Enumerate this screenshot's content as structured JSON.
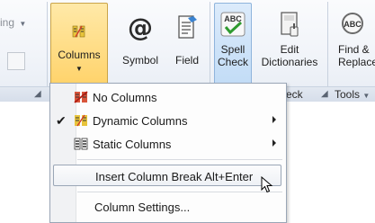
{
  "ribbon": {
    "stub_label": "ing",
    "buttons": [
      {
        "label": "Columns",
        "icon": "columns-icon"
      },
      {
        "label": "Symbol",
        "icon": "at-symbol-icon",
        "glyph": "@"
      },
      {
        "label": "Field",
        "icon": "field-icon"
      },
      {
        "label": "Spell Check",
        "line1": "Spell",
        "line2": "Check",
        "icon": "spell-check-icon"
      },
      {
        "label": "Edit Dictionaries",
        "line1": "Edit",
        "line2": "Dictionaries",
        "icon": "edit-dictionaries-icon"
      },
      {
        "label": "Find & Replace",
        "line1": "Find &",
        "line2": "Replace",
        "icon": "find-replace-icon"
      }
    ],
    "spell_check_icon_text": "ABC",
    "find_icon_text": "ABC",
    "groups": [
      {
        "label": "eck"
      },
      {
        "label": "Tools"
      }
    ]
  },
  "menu": {
    "items": [
      {
        "label": "No Columns",
        "icon": "no-columns-icon",
        "checked": false,
        "submenu": false
      },
      {
        "label": "Dynamic Columns",
        "icon": "dynamic-columns-icon",
        "checked": true,
        "submenu": true,
        "check_glyph": "✔"
      },
      {
        "label": "Static Columns",
        "icon": "static-columns-icon",
        "checked": false,
        "submenu": true
      },
      {
        "label": "Insert Column Break Alt+Enter",
        "checked": false,
        "submenu": false,
        "hovered": true
      },
      {
        "label": "Column Settings...",
        "checked": false,
        "submenu": false
      }
    ]
  },
  "colors": {
    "pressed_bg": "#ffd36b",
    "selected_bg": "#c2dcf6",
    "ribbon_border": "#c5d0de"
  }
}
